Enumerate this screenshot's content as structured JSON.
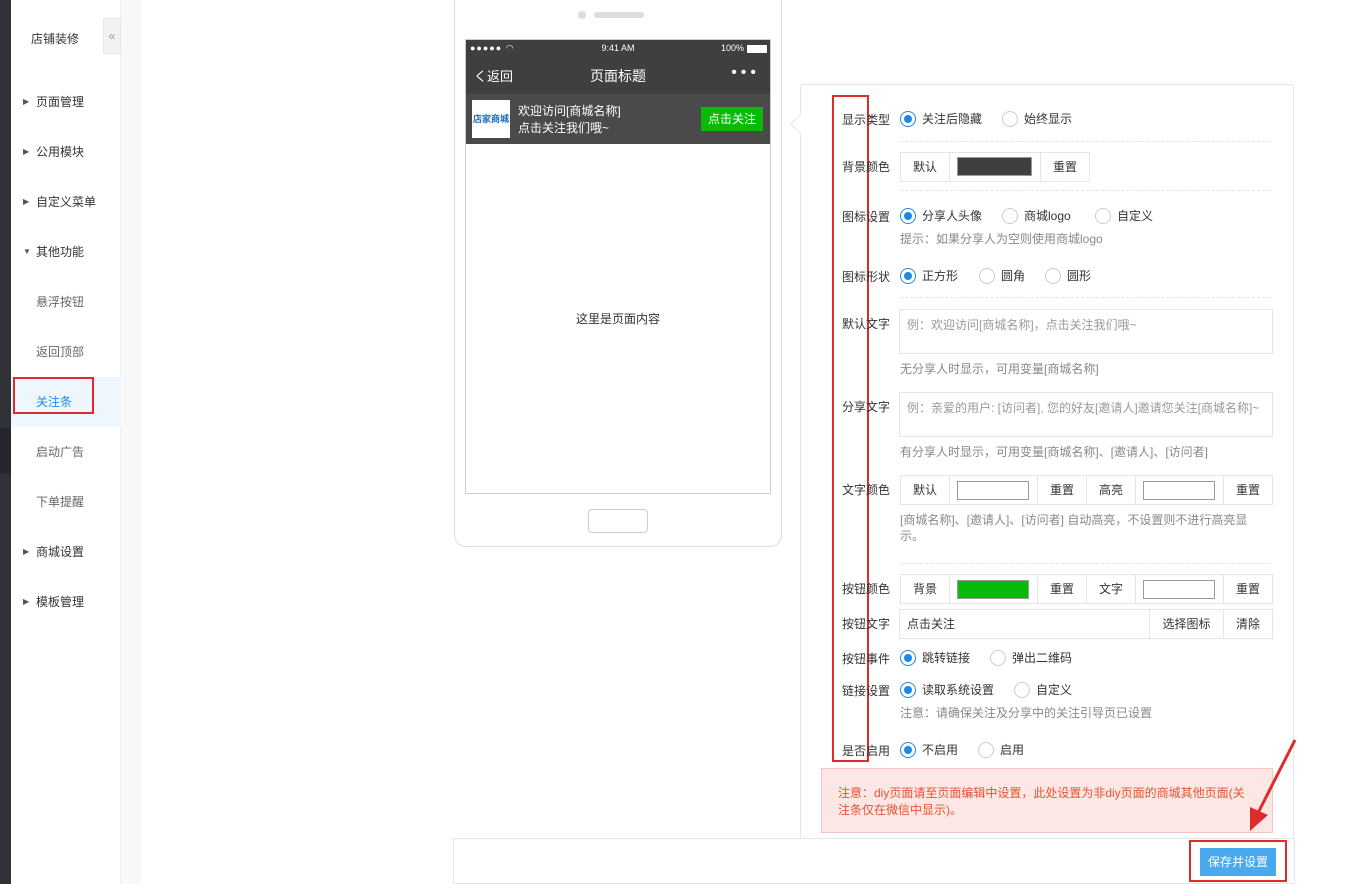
{
  "sidebar": {
    "title": "店铺装修",
    "collapse_icon": "«",
    "items": [
      {
        "label": "页面管理",
        "arrow": "▶"
      },
      {
        "label": "公用模块",
        "arrow": "▶"
      },
      {
        "label": "自定义菜单",
        "arrow": "▶"
      },
      {
        "label": "其他功能",
        "arrow": "▼"
      },
      {
        "label": "悬浮按钮"
      },
      {
        "label": "返回顶部"
      },
      {
        "label": "关注条"
      },
      {
        "label": "启动广告"
      },
      {
        "label": "下单提醒"
      },
      {
        "label": "商城设置",
        "arrow": "▶"
      },
      {
        "label": "模板管理",
        "arrow": "▶"
      }
    ]
  },
  "phone": {
    "status_left": "●●●●● ◠",
    "time": "9:41 AM",
    "battery": "100%",
    "back": "く返回",
    "title": "页面标题",
    "more": "•••",
    "logo_text": "店家商城",
    "follow_line1": "欢迎访问[商城名称]",
    "follow_line2": "点击关注我们哦~",
    "follow_button": "点击关注",
    "content": "这里是页面内容"
  },
  "form": {
    "display_type": {
      "label": "显示类型",
      "options": [
        "关注后隐藏",
        "始终显示"
      ]
    },
    "bg_color": {
      "label": "背景颜色",
      "default": "默认",
      "reset": "重置",
      "color": "#3f3f3f"
    },
    "icon_setting": {
      "label": "图标设置",
      "options": [
        "分享人头像",
        "商城logo",
        "自定义"
      ],
      "hint": "提示：如果分享人为空则使用商城logo"
    },
    "icon_shape": {
      "label": "图标形状",
      "options": [
        "正方形",
        "圆角",
        "圆形"
      ]
    },
    "default_text": {
      "label": "默认文字",
      "placeholder": "例：欢迎访问[商城名称]，点击关注我们哦~",
      "hint": "无分享人时显示，可用变量[商城名称]"
    },
    "share_text": {
      "label": "分享文字",
      "placeholder": "例：亲爱的用户: [访问者], 您的好友[邀请人]邀请您关注[商城名称]~",
      "hint": "有分享人时显示，可用变量[商城名称]、[邀请人]、[访问者]"
    },
    "text_color": {
      "label": "文字颜色",
      "default": "默认",
      "reset": "重置",
      "highlight": "高亮",
      "reset2": "重置",
      "hint": "[商城名称]、[邀请人]、[访问者] 自动高亮，不设置则不进行高亮显示。"
    },
    "button_color": {
      "label": "按钮颜色",
      "bg": "背景",
      "reset": "重置",
      "text": "文字",
      "reset2": "重置",
      "color": "#09bb07"
    },
    "button_text": {
      "label": "按钮文字",
      "value": "点击关注",
      "choose_icon": "选择图标",
      "clear": "清除"
    },
    "button_event": {
      "label": "按钮事件",
      "options": [
        "跳转链接",
        "弹出二维码"
      ]
    },
    "link_setting": {
      "label": "链接设置",
      "options": [
        "读取系统设置",
        "自定义"
      ],
      "hint": "注意：请确保关注及分享中的关注引导页已设置"
    },
    "enabled": {
      "label": "是否启用",
      "options": [
        "不启用",
        "启用"
      ]
    },
    "notice": "注意：diy页面请至页面编辑中设置，此处设置为非diy页面的商城其他页面(关注条仅在微信中显示)。",
    "save": "保存并设置"
  },
  "colors": {
    "accent": "#1e88e5",
    "annotation_red": "#e02b2b",
    "follow_green": "#09bb07"
  }
}
